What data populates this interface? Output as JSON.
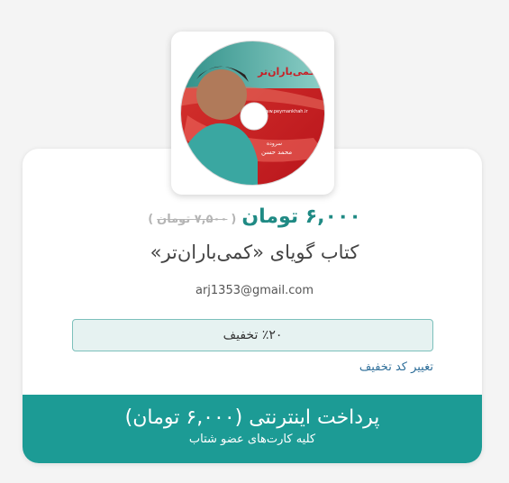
{
  "product": {
    "cover_alt": "کتاب گویای «کمی‌باران‌تر»",
    "price_new": "۶,۰۰۰ تومان",
    "price_old": "۷,۵۰۰ تومان",
    "open_paren": "(",
    "close_paren": ")",
    "title": "کتاب گویای «کمی‌باران‌تر»"
  },
  "user": {
    "email": "arj1353@gmail.com"
  },
  "discount": {
    "label": "٪۲۰ تخفیف",
    "change_link": "تغییر کد تخفیف"
  },
  "payment": {
    "button_label": "پرداخت اینترنتی (۶,۰۰۰ تومان)",
    "subtitle": "کلیه کارت‌های عضو شتاب"
  },
  "colors": {
    "accent": "#1c9b95",
    "price": "#1f8a84",
    "link": "#2f6f9a"
  }
}
